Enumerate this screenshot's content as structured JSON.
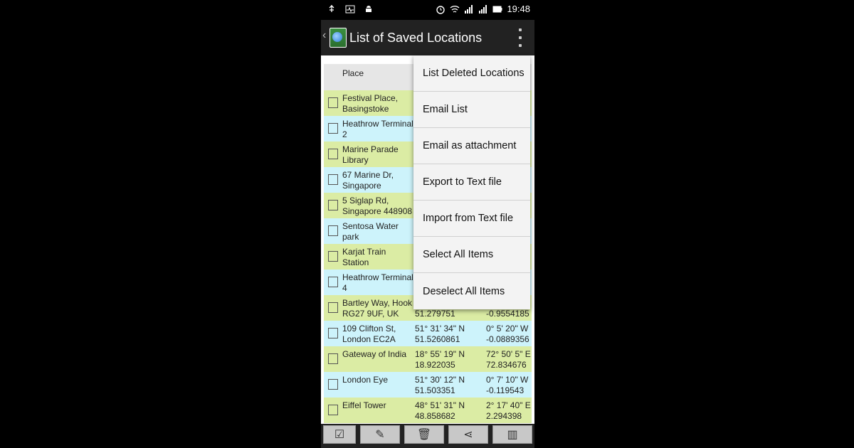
{
  "status_bar": {
    "time": "19:48",
    "left_icons": [
      "usb-icon",
      "activity-icon",
      "android-icon"
    ],
    "right_icons": [
      "alarm-icon",
      "wifi-icon",
      "signal-icon",
      "signal-2-icon",
      "battery-icon"
    ]
  },
  "action_bar": {
    "title": "List of Saved Locations",
    "back_icon": "chevron-left-icon",
    "app_icon": "map-globe-icon",
    "overflow_icon": "more-vertical-icon"
  },
  "table": {
    "header": {
      "place": "Place"
    },
    "rows": [
      {
        "place": "Festival Place, Basingstoke",
        "lat_dms": "",
        "lat_dec": "",
        "lng_dms": "",
        "lng_dec": "",
        "color": "#dbeca4"
      },
      {
        "place": "Heathrow Terminal 2",
        "lat_dms": "",
        "lat_dec": "",
        "lng_dms": "",
        "lng_dec": "",
        "color": "#cdf3fb"
      },
      {
        "place": "Marine Parade Library",
        "lat_dms": "",
        "lat_dec": "",
        "lng_dms": "",
        "lng_dec": "",
        "color": "#dbeca4"
      },
      {
        "place": "67 Marine Dr, Singapore",
        "lat_dms": "",
        "lat_dec": "",
        "lng_dms": "",
        "lng_dec": "",
        "color": "#cdf3fb"
      },
      {
        "place": "5 Siglap Rd, Singapore 448908",
        "lat_dms": "",
        "lat_dec": "",
        "lng_dms": "",
        "lng_dec": "",
        "color": "#dbeca4"
      },
      {
        "place": "Sentosa Water park",
        "lat_dms": "",
        "lat_dec": "",
        "lng_dms": "",
        "lng_dec": "",
        "color": "#cdf3fb"
      },
      {
        "place": "Karjat Train Station",
        "lat_dms": "",
        "lat_dec": "",
        "lng_dms": "",
        "lng_dec": "",
        "color": "#dbeca4"
      },
      {
        "place": "Heathrow Terminal 4",
        "lat_dms": "",
        "lat_dec": "",
        "lng_dms": "",
        "lng_dec": "",
        "color": "#cdf3fb"
      },
      {
        "place": "Bartley Way, Hook RG27 9UF, UK",
        "lat_dms": "",
        "lat_dec": "51.279751",
        "lng_dms": "",
        "lng_dec": "-0.9554185",
        "color": "#dbeca4"
      },
      {
        "place": "109 Clifton St, London EC2A 4LD, UK",
        "lat_dms": "51° 31' 34\" N",
        "lat_dec": "51.5260861",
        "lng_dms": "0° 5' 20\" W",
        "lng_dec": "-0.0889356",
        "color": "#cdf3fb"
      },
      {
        "place": "Gateway of India",
        "lat_dms": "18° 55' 19\" N",
        "lat_dec": "18.922035",
        "lng_dms": "72° 50' 5\" E",
        "lng_dec": "72.834676",
        "color": "#dbeca4"
      },
      {
        "place": "London Eye",
        "lat_dms": "51° 30' 12\" N",
        "lat_dec": "51.503351",
        "lng_dms": "0° 7' 10\" W",
        "lng_dec": "-0.119543",
        "color": "#cdf3fb"
      },
      {
        "place": "Eiffel Tower",
        "lat_dms": "48° 51' 31\" N",
        "lat_dec": "48.858682",
        "lng_dms": "2° 17' 40\" E",
        "lng_dec": "2.294398",
        "color": "#dbeca4"
      }
    ]
  },
  "menu": {
    "items": [
      "List Deleted Locations",
      "Email List",
      "Email as attachment",
      "Export to Text file",
      "Import from Text file",
      "Select All Items",
      "Deselect All Items"
    ]
  },
  "bottom_bar": {
    "buttons": [
      {
        "icon": "checkmark-icon",
        "glyph": "☑"
      },
      {
        "icon": "pencil-icon",
        "glyph": "✎"
      },
      {
        "icon": "trash-icon",
        "glyph": "🗑"
      },
      {
        "icon": "share-icon",
        "glyph": "⋖"
      },
      {
        "icon": "map-icon",
        "glyph": "▥"
      }
    ]
  }
}
